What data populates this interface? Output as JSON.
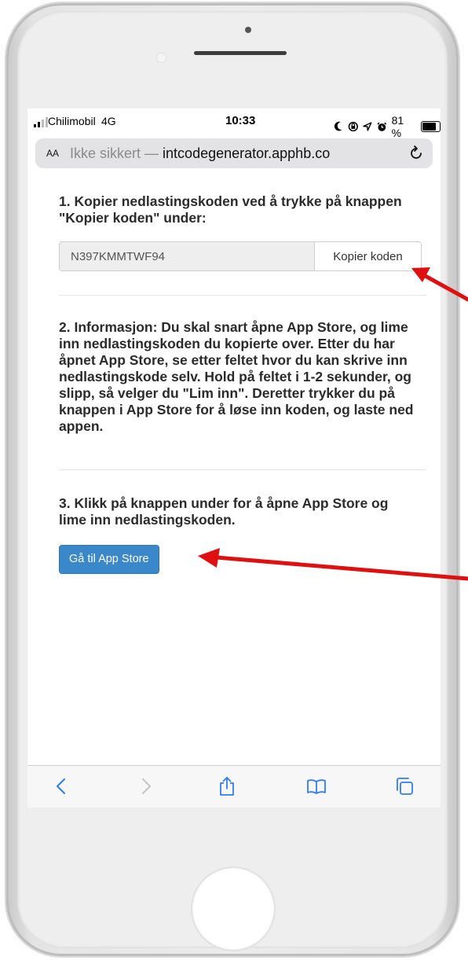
{
  "status_bar": {
    "carrier": "Chilimobil",
    "network": "4G",
    "time": "10:33",
    "battery": "81 %",
    "battery_level": 0.81
  },
  "url_bar": {
    "aa_label": "AA",
    "insecure_label": "Ikke sikkert —",
    "domain": "intcodegenerator.apphb.co"
  },
  "steps": {
    "step1": "1. Kopier nedlastingskoden ved å trykke på knappen \"Kopier koden\" under:",
    "code_value": "N397KMMTWF94",
    "copy_button": "Kopier koden",
    "step2": "2. Informasjon: Du skal snart åpne App Store, og lime inn nedlastingskoden du kopierte over. Etter du har åpnet App Store, se etter feltet hvor du kan skrive inn nedlastingskode selv. Hold på feltet i 1-2 sekunder, og slipp, så velger du \"Lim inn\". Deretter trykker du på knappen i App Store for å løse inn koden, og laste ned appen.",
    "step3": "3. Klikk på knappen under for å åpne App Store og lime inn nedlastingskoden.",
    "appstore_button": "Gå til App Store"
  },
  "toolbar": {
    "icons": [
      "back-icon",
      "forward-icon",
      "share-icon",
      "bookmarks-icon",
      "tabs-icon"
    ]
  },
  "colors": {
    "accent_button": "#3a87c9",
    "annotation_arrow": "#e01010"
  }
}
